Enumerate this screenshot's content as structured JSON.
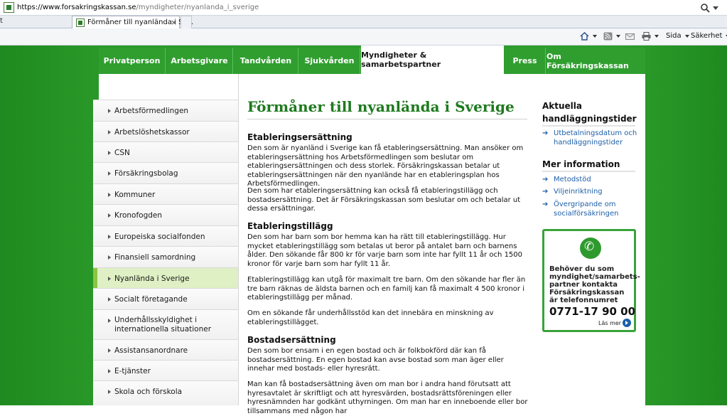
{
  "browser": {
    "url_host": "https://www.forsakringskassan.se",
    "url_path": "/myndigheter/nyanlanda_i_sverige",
    "prev_tab_label": "t",
    "tab_title": "Förmåner till nyanlända i Sv...",
    "tab_close": "×",
    "command_bar": {
      "page_label": "Sida",
      "safety_label": "Säkerhet"
    }
  },
  "nav": {
    "tabs": [
      {
        "label": "Privatperson"
      },
      {
        "label": "Arbetsgivare"
      },
      {
        "label": "Tandvården"
      },
      {
        "label": "Sjukvården"
      },
      {
        "label": "Myndigheter & samarbetspartner",
        "active": true
      },
      {
        "label": "Press"
      },
      {
        "label": "Om Försäkringskassan"
      }
    ]
  },
  "sidebar": {
    "items": [
      {
        "label": "Arbetsförmedlingen"
      },
      {
        "label": "Arbetslöshetskassor"
      },
      {
        "label": "CSN"
      },
      {
        "label": "Försäkringsbolag"
      },
      {
        "label": "Kommuner"
      },
      {
        "label": "Kronofogden"
      },
      {
        "label": "Europeiska socialfonden"
      },
      {
        "label": "Finansiell samordning"
      },
      {
        "label": "Nyanlända i Sverige",
        "active": true
      },
      {
        "label": "Socialt företagande"
      },
      {
        "label": "Underhållsskyldighet i internationella situationer"
      },
      {
        "label": "Assistansanordnare"
      },
      {
        "label": "E-tjänster"
      },
      {
        "label": "Skola och förskola"
      }
    ]
  },
  "main": {
    "title": "Förmåner till nyanlända i Sverige",
    "sections": {
      "etablering_heading": "Etableringsersättning",
      "etablering_p1": "Den som är nyanländ i Sverige kan få etableringsersättning. Man ansöker om etableringsersättning hos Arbetsförmedlingen som beslutar om etableringsersättningen och dess storlek. Försäkringskassan betalar ut etableringsersättningen när den nyanlände har en etableringsplan hos Arbetsförmedlingen.",
      "etablering_p2": "Den som har etableringsersättning kan också få etableringstillägg och bostadsersättning. Det är Försäkringskassan som beslutar om och betalar ut dessa ersättningar.",
      "tillagg_heading": "Etableringstillägg",
      "tillagg_p1": "Den som har barn som bor hemma kan ha rätt till etableringstillägg. Hur mycket etableringstillägg som betalas ut beror på antalet barn och barnens ålder. Den sökande får 800 kr för varje barn som inte har fyllt 11 år och 1500  kronor  för varje barn som har fyllt 11 år.",
      "tillagg_p2": "Etableringstillägg kan utgå för maximalt tre barn. Om den sökande har fler än tre barn räknas de äldsta barnen och en familj kan få maximalt 4 500 kronor i etableringstillägg per månad.",
      "tillagg_p3": "Om en sökande får underhållsstöd kan det innebära en minskning av etableringstillägget.",
      "bostad_heading": "Bostadsersättning",
      "bostad_p1": "Den som bor ensam i en egen bostad och är folkbokförd där kan få bostadsersättning. En egen bostad kan avse bostad som man äger eller innehar med bostads- eller hyresrätt.",
      "bostad_p2": "Man kan få bostadsersättning även om man bor i andra hand förutsatt att hyresavtalet är skriftligt och att hyresvärden, bostadsrättsföreningen eller hyresnämnden har godkänt uthyrningen. Om man har en inneboende eller bor tillsammans med någon har"
    }
  },
  "right": {
    "aktuella_heading": "Aktuella handläggningstider",
    "aktuella_links": [
      {
        "label": "Utbetalningsdatum och handläggningstider"
      }
    ],
    "mer_heading": "Mer information",
    "mer_links": [
      {
        "label": "Metodstöd"
      },
      {
        "label": "Viljeinriktning"
      },
      {
        "label": "Övergripande om socialförsäkringen"
      }
    ],
    "promo": {
      "text": "Behöver du som myndighet/samarbets-partner kontakta Försäkringskassan är telefonnumret",
      "phone": "0771-17 90 00",
      "more": "Läs mer"
    }
  }
}
